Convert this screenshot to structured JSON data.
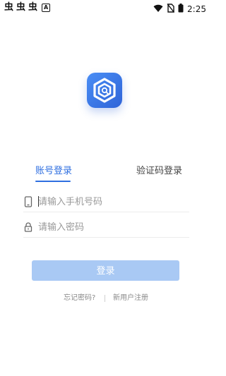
{
  "status_bar": {
    "left_glyphs": [
      "虫",
      "虫",
      "虫"
    ],
    "notification_badge": "A",
    "time": "2:25",
    "icons": [
      "wifi-icon",
      "no-sim-icon",
      "battery-icon"
    ]
  },
  "logo": {
    "icon": "app-logo-icon",
    "accent": "#2f64d8"
  },
  "tabs": {
    "account": "账号登录",
    "sms": "验证码登录",
    "active_color": "#2f6fe0"
  },
  "form": {
    "phone": {
      "placeholder": "请输入手机号码",
      "value": "",
      "icon": "phone-icon"
    },
    "password": {
      "placeholder": "请输入密码",
      "value": "",
      "icon": "lock-icon"
    }
  },
  "login_button": {
    "label": "登录",
    "color": "#a9c9f4"
  },
  "links": {
    "forgot_password": "忘记密码?",
    "register": "新用户注册"
  }
}
